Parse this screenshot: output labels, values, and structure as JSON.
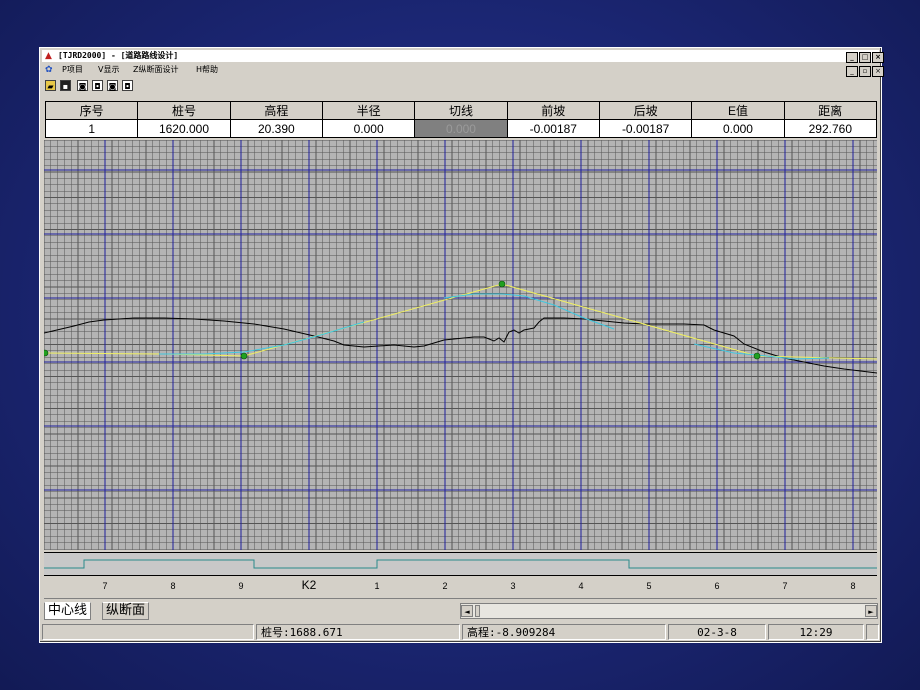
{
  "window": {
    "title": "[TJRD2000] - [道路路线设计]",
    "caption_buttons": [
      "_",
      "□",
      "×"
    ],
    "mdi_buttons": [
      "_",
      "▫",
      "×"
    ]
  },
  "menu": {
    "items": [
      "P项目",
      "V显示",
      "Z纵断面设计",
      "H帮助"
    ]
  },
  "toolbar": {
    "buttons": [
      "open-icon",
      "save-icon",
      "zoom-in-icon",
      "zoom-out-icon",
      "zoom-window-icon",
      "zoom-all-icon"
    ]
  },
  "table": {
    "headers": [
      "序号",
      "桩号",
      "高程",
      "半径",
      "切线",
      "前坡",
      "后坡",
      "E值",
      "距离"
    ],
    "row": [
      "1",
      "1620.000",
      "20.390",
      "0.000",
      "0.000",
      "-0.00187",
      "-0.00187",
      "0.000",
      "292.760"
    ]
  },
  "profile": {
    "grid_minor_color": "#555555",
    "grid_major_color": "#1e1e9c",
    "background": "#b4b4b4",
    "ground_line_color": "#000000",
    "design_line_color": "#f0f060",
    "vertical_curve_color": "#40c8e0",
    "pvi_point_color": "#20a020"
  },
  "ruler": {
    "labels": [
      "7",
      "8",
      "9",
      "K2",
      "1",
      "2",
      "3",
      "4",
      "5",
      "6",
      "7",
      "8"
    ]
  },
  "tabs": [
    "中心线",
    "纵断面"
  ],
  "status": {
    "empty": "",
    "station": "桩号:1688.671",
    "elevation": "高程:-8.909284",
    "date": "02-3-8",
    "time": "12:29"
  }
}
